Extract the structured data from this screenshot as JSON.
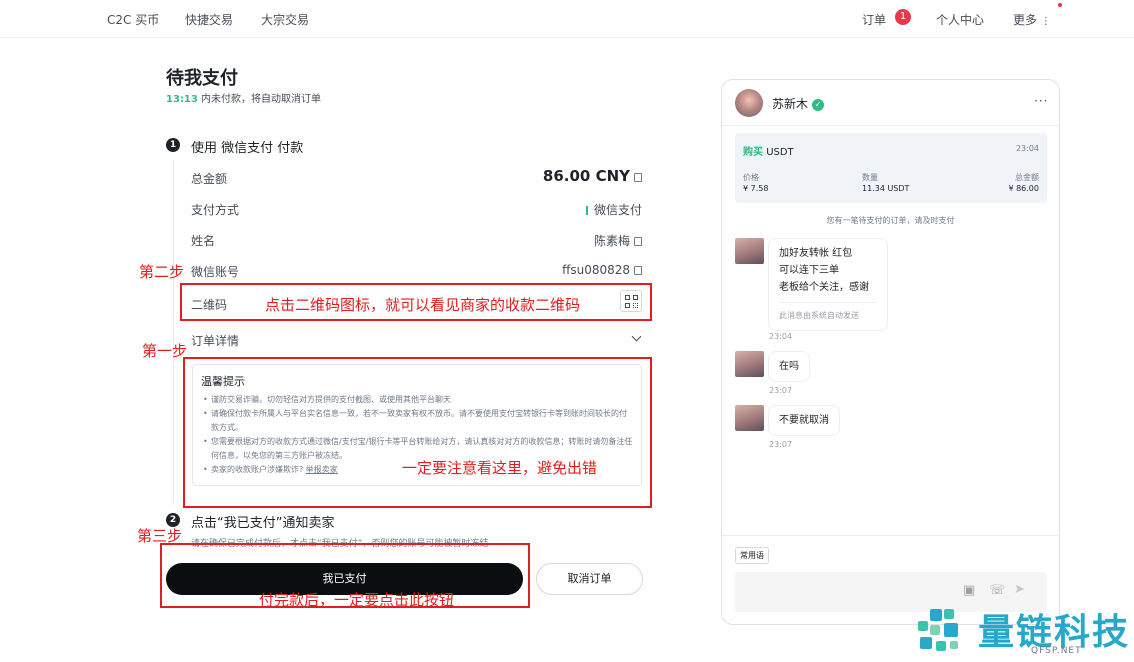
{
  "nav": {
    "left": [
      "C2C 买币",
      "快捷交易",
      "大宗交易"
    ],
    "right": {
      "orders": "订单",
      "orders_count": "1",
      "profile": "个人中心",
      "more": "更多"
    }
  },
  "page": {
    "title": "待我支付",
    "countdown": "13:13",
    "countdown_text": "内未付款，将自动取消订单"
  },
  "step1": {
    "number": "1",
    "title": "使用 微信支付 付款",
    "rows": [
      {
        "label": "总金额",
        "value": "86.00 CNY"
      },
      {
        "label": "支付方式",
        "value": "微信支付"
      },
      {
        "label": "姓名",
        "value": "陈素梅"
      },
      {
        "label": "微信账号",
        "value": "ffsu080828"
      },
      {
        "label": "二维码",
        "value": ""
      }
    ],
    "order_detail": "订单详情"
  },
  "tips": {
    "title": "温馨提示",
    "items": [
      "谨防交易诈骗，切勿轻信对方提供的支付截图、或使用其他平台聊天",
      "请确保付款卡所属人与平台实名信息一致，若不一致卖家有权不放币。请不要使用支付宝转银行卡等到账时间较长的付款方式。",
      "您需要根据对方的收款方式通过微信/支付宝/银行卡等平台转账给对方，请认真核对对方的收款信息；转账时请勿备注任何信息，以免您的第三方账户被冻结。"
    ],
    "last_item": "卖家的收款账户涉嫌欺诈?",
    "report_link": "举报卖家"
  },
  "step2": {
    "number": "2",
    "title": "点击“我已支付”通知卖家",
    "notice": "请在确保已完成付款后，才点击“我已支付”，否则您的账号可能被暂时冻结"
  },
  "buttons": {
    "paid": "我已支付",
    "cancel": "取消订单"
  },
  "annotations": {
    "step_two": "第二步",
    "step_two_note": "点击二维码图标，就可以看见商家的收款二维码",
    "step_one": "第一步",
    "step_one_note": "一定要注意看这里，避免出错",
    "step_three": "第三步",
    "step_three_note": "付完款后，一定要点击此按钮"
  },
  "chat": {
    "name": "苏新木",
    "order": {
      "side": "购买",
      "asset": "USDT",
      "time": "23:04",
      "price_label": "价格",
      "price": "¥ 7.58",
      "qty_label": "数量",
      "qty": "11.34 USDT",
      "total_label": "总金额",
      "total": "¥ 86.00"
    },
    "system_note": "您有一笔待支付的订单，请及时支付",
    "messages": [
      {
        "lines": [
          "加好友转帐  红包",
          "可以连下三单",
          "老板给个关注，感谢"
        ],
        "auto": "此消息由系统自动发送",
        "time": "23:04"
      },
      {
        "lines": [
          "在吗"
        ],
        "time": "23:07"
      },
      {
        "lines": [
          "不要就取消"
        ],
        "time": "23:07"
      }
    ],
    "quick_reply": "常用语"
  },
  "watermark": {
    "cn": "量链科技",
    "en": "QFSP.NET"
  },
  "colors": {
    "accent_green": "#2ebd85",
    "annotation_red": "#e02020",
    "badge_red": "#e8374c",
    "primary_button": "#0b0e11",
    "watermark": "#26a9c8"
  },
  "icons": [
    "copy-icon",
    "qr-code-icon",
    "chevron-down-icon",
    "verified-icon",
    "image-icon",
    "phone-icon",
    "send-icon",
    "more-icon"
  ]
}
